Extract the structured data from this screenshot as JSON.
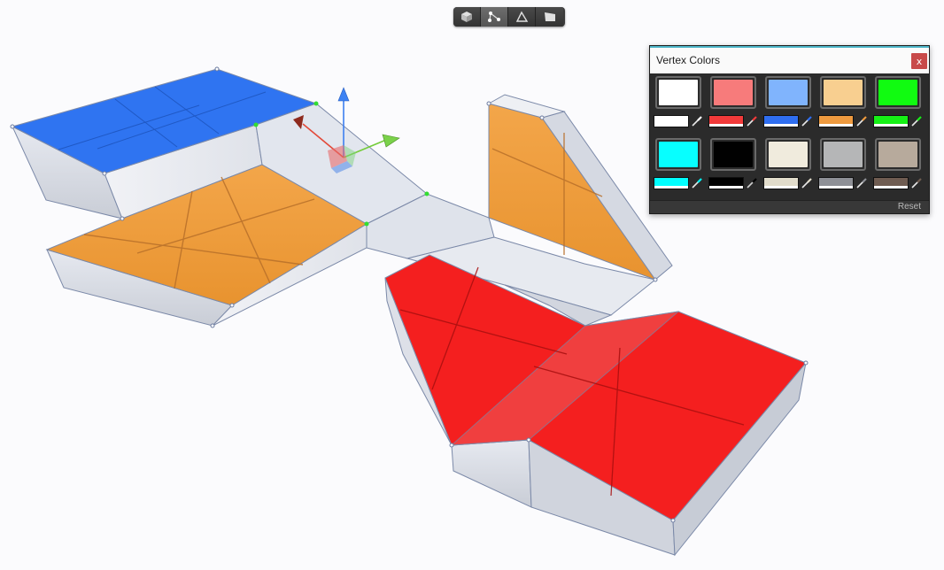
{
  "toolbar": {
    "modes": [
      {
        "icon": "object-mode-icon",
        "active": false
      },
      {
        "icon": "vertex-mode-icon",
        "active": true
      },
      {
        "icon": "edge-mode-icon",
        "active": false
      },
      {
        "icon": "face-mode-icon",
        "active": false
      }
    ]
  },
  "vertex_colors": {
    "title": "Vertex Colors",
    "close_label": "x",
    "reset_label": "Reset",
    "swatches": [
      {
        "color": "#ffffff"
      },
      {
        "color": "#f77b7b"
      },
      {
        "color": "#80b4fd"
      },
      {
        "color": "#f8cf90"
      },
      {
        "color": "#11fb11"
      },
      {
        "color": "#07ffff"
      },
      {
        "color": "#010101"
      },
      {
        "color": "#f0ebdd"
      },
      {
        "color": "#b5b6b7"
      },
      {
        "color": "#b7aa9c"
      }
    ],
    "small_swatches": [
      {
        "color": "#ffffff"
      },
      {
        "color": "#f23a3a"
      },
      {
        "color": "#2f6ef0"
      },
      {
        "color": "#ee9a3f"
      },
      {
        "color": "#16f016"
      },
      {
        "color": "#00ffff"
      },
      {
        "color": "#000000"
      },
      {
        "color": "#e1dccb"
      },
      {
        "color": "#8e9096"
      },
      {
        "color": "#6f5c51"
      }
    ]
  },
  "scene": {
    "face_colors": {
      "blue": "#2f74f1",
      "orange": "#f19e3b",
      "red": "#f41f1f",
      "gray": "#d7dbe4"
    }
  }
}
